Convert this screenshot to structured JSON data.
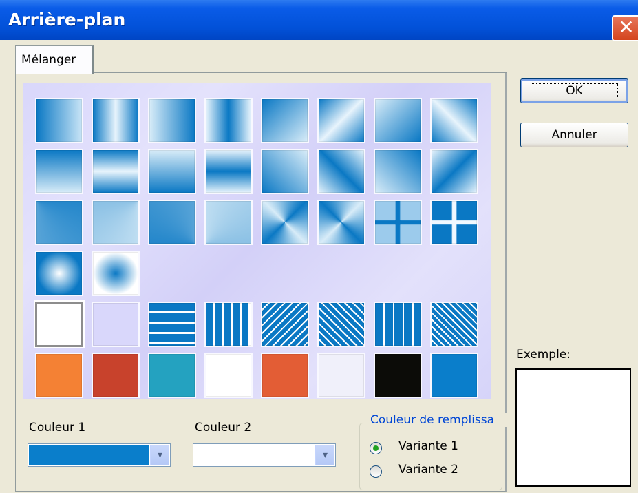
{
  "window": {
    "title": "Arrière-plan",
    "close_glyph": "✕"
  },
  "tabs": [
    {
      "label": "Mélanger"
    }
  ],
  "swatches": [
    {
      "name": "swatch-gradient-h-1",
      "bg": "linear-gradient(90deg,#0a78c4,#c8e4f6)"
    },
    {
      "name": "swatch-gradient-h-2",
      "bg": "linear-gradient(90deg,#0a78c4,#e8f4fc 50%,#0a78c4)"
    },
    {
      "name": "swatch-gradient-h-3",
      "bg": "linear-gradient(90deg,#d8ecf8,#0a78c4)"
    },
    {
      "name": "swatch-gradient-h-4",
      "bg": "linear-gradient(90deg,#e8f4fc,#0a78c4 50%,#e8f4fc)"
    },
    {
      "name": "swatch-gradient-d-1",
      "bg": "linear-gradient(135deg,#0a78c4,#d8ecf8)"
    },
    {
      "name": "swatch-gradient-d-2",
      "bg": "linear-gradient(135deg,#0a78c4,#e8f4fc 50%,#0a78c4)"
    },
    {
      "name": "swatch-gradient-d-3",
      "bg": "linear-gradient(135deg,#d8ecf8,#0a78c4)"
    },
    {
      "name": "swatch-gradient-d-4",
      "bg": "linear-gradient(45deg,#0a78c4,#e8f4fc 50%,#0a78c4)"
    },
    {
      "name": "swatch-gradient-v-1",
      "bg": "linear-gradient(180deg,#0a78c4,#d8ecf8)"
    },
    {
      "name": "swatch-gradient-v-2",
      "bg": "linear-gradient(180deg,#0a78c4,#e8f4fc 50%,#0a78c4)"
    },
    {
      "name": "swatch-gradient-v-3",
      "bg": "linear-gradient(180deg,#d8ecf8,#0a78c4)"
    },
    {
      "name": "swatch-gradient-v-4",
      "bg": "linear-gradient(180deg,#e8f4fc,#0a78c4 50%,#e8f4fc)"
    },
    {
      "name": "swatch-gradient-d-5",
      "bg": "linear-gradient(45deg,#0a78c4,#d8ecf8)"
    },
    {
      "name": "swatch-gradient-d-6",
      "bg": "linear-gradient(45deg,#e8f4fc,#0a78c4 50%,#e8f4fc)"
    },
    {
      "name": "swatch-gradient-d-7",
      "bg": "linear-gradient(45deg,#d8ecf8,#0a78c4)"
    },
    {
      "name": "swatch-gradient-d-8",
      "bg": "linear-gradient(135deg,#e8f4fc,#0a78c4 50%,#e8f4fc)"
    },
    {
      "name": "swatch-corner-1",
      "bg": "conic-gradient(from 45deg at 0% 0%,#0a78c4,#d8ecf8)"
    },
    {
      "name": "swatch-corner-2",
      "bg": "conic-gradient(from 135deg at 100% 0%,#d8ecf8,#0a78c4)"
    },
    {
      "name": "swatch-corner-3",
      "bg": "conic-gradient(from 225deg at 100% 100%,#0a78c4,#d8ecf8)"
    },
    {
      "name": "swatch-corner-4",
      "bg": "conic-gradient(from 315deg at 0% 100%,#d8ecf8,#0a78c4)"
    },
    {
      "name": "swatch-box-1",
      "bg": "conic-gradient(from 45deg,#0a78c4,#d8ecf8,#0a78c4,#d8ecf8,#0a78c4)"
    },
    {
      "name": "swatch-box-2",
      "bg": "conic-gradient(from 45deg,#d8ecf8,#0a78c4,#d8ecf8,#0a78c4,#d8ecf8)"
    },
    {
      "name": "swatch-cross-1",
      "bg": "radial-gradient(circle,#0a78c4 10%,transparent 11%),linear-gradient(90deg,transparent 44%,#0a78c4 46%,#0a78c4 54%,transparent 56%),linear-gradient(180deg,transparent 44%,#0a78c4 46%,#0a78c4 54%,transparent 56%),#9ccbec"
    },
    {
      "name": "swatch-cross-2",
      "bg": "linear-gradient(90deg,transparent 44%,#f0f8ff 46%,#f0f8ff 54%,transparent 56%),linear-gradient(180deg,transparent 44%,#f0f8ff 46%,#f0f8ff 54%,transparent 56%),#0a78c4"
    },
    {
      "name": "swatch-radial-1",
      "bg": "radial-gradient(circle,#ffffff 0%,#0a78c4 70%)"
    },
    {
      "name": "swatch-radial-2",
      "bg": "radial-gradient(ellipse,#0a78c4 0%,#ffffff 70%)"
    },
    {
      "name": "swatch-plain-white",
      "bg": "#ffffff"
    },
    {
      "name": "swatch-plain-lavender",
      "bg": "#d9d7fb"
    },
    {
      "name": "swatch-stripes-horizontal",
      "bg": "repeating-linear-gradient(180deg,#0a78c4 0 12px,#ffffff 12px 15px)"
    },
    {
      "name": "swatch-stripes-vertical",
      "bg": "repeating-linear-gradient(90deg,#0a78c4 0 10px,#ffffff 10px 13px)"
    },
    {
      "name": "swatch-stripes-diagonal-up",
      "bg": "repeating-linear-gradient(135deg,#0a78c4 0 6px,#ffffff 6px 8px)"
    },
    {
      "name": "swatch-stripes-diagonal-down",
      "bg": "repeating-linear-gradient(45deg,#0a78c4 0 6px,#ffffff 6px 8px)"
    },
    {
      "name": "swatch-grid",
      "bg": "repeating-linear-gradient(90deg,#0a78c4 0 12px,#ffffff 12px 14px),repeating-linear-gradient(180deg,transparent 0 12px,#ffffff 12px 14px)"
    },
    {
      "name": "swatch-crosshatch",
      "bg": "repeating-linear-gradient(45deg,#0a78c4 0 5px,#ffffff 5px 7px),repeating-linear-gradient(135deg,#0a78c4 0 5px,#ffffff 5px 7px)"
    },
    {
      "name": "swatch-solid-orange",
      "bg": "#f48134"
    },
    {
      "name": "swatch-solid-red",
      "bg": "#c8422c"
    },
    {
      "name": "swatch-solid-teal",
      "bg": "#24a2c0"
    },
    {
      "name": "swatch-solid-white",
      "bg": "#ffffff"
    },
    {
      "name": "swatch-solid-orange-red",
      "bg": "#e35d35"
    },
    {
      "name": "swatch-solid-very-light",
      "bg": "#f0f0fa"
    },
    {
      "name": "swatch-solid-black",
      "bg": "#0c0c08"
    },
    {
      "name": "swatch-solid-blue",
      "bg": "#0a7ecb"
    }
  ],
  "color1": {
    "label": "Couleur 1",
    "value_color": "#0a7ecb"
  },
  "color2": {
    "label": "Couleur 2",
    "value_color": "#ffffff"
  },
  "dropdown_glyph": "▾",
  "fill": {
    "title": "Couleur de remplissa",
    "options": [
      {
        "label": "Variante 1",
        "checked": true
      },
      {
        "label": "Variante 2",
        "checked": false
      }
    ]
  },
  "buttons": {
    "ok": "OK",
    "cancel": "Annuler"
  },
  "preview": {
    "label": "Exemple:"
  }
}
